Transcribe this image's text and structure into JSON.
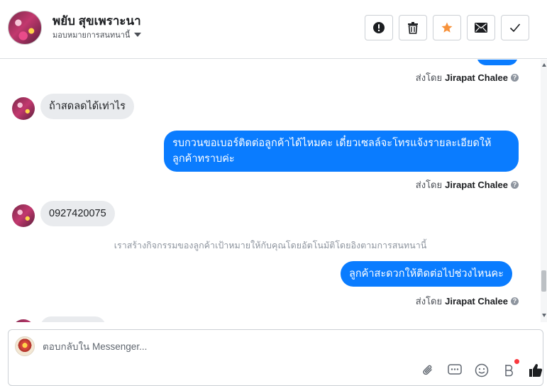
{
  "header": {
    "contact_name": "พยับ สุขเพราะนา",
    "subtitle": "มอบหมายการสนทนานี้",
    "actions": [
      {
        "name": "mark-spam-button",
        "icon": "alert-icon"
      },
      {
        "name": "delete-button",
        "icon": "trash-icon"
      },
      {
        "name": "star-button",
        "icon": "star-icon",
        "color": "#f7923b"
      },
      {
        "name": "mark-unread-button",
        "icon": "envelope-icon"
      },
      {
        "name": "mark-done-button",
        "icon": "check-icon"
      }
    ]
  },
  "messages": {
    "sent_by_prefix": "ส่งโดย",
    "sender_name": "Jirapat Chalee",
    "in_1": "ถ้าสดลดได้เท่าไร",
    "out_1": "รบกวนขอเบอร์ติดต่อลูกค้าได้ไหมคะ เดี๋ยวเซลล์จะโทรแจ้งรายละเอียดให้ลูกค้าทราบค่ะ",
    "in_2": "0927420075",
    "system_note": "เราสร้างกิจกรรมของลูกค้าเป้าหมายให้กับคุณโดยอัตโนมัติโดยอิงตามการสนทนานี้",
    "out_2": "ลูกค้าสะดวกให้ติดต่อไปช่วงไหนคะ"
  },
  "composer": {
    "placeholder": "ตอบกลับใน Messenger...",
    "tools": [
      "paperclip-icon",
      "saved-replies-icon",
      "emoji-icon",
      "payment-icon",
      "like-icon"
    ]
  },
  "colors": {
    "outgoing_bubble": "#0a7cff",
    "incoming_bubble": "#e9ebee",
    "star": "#f7923b"
  }
}
